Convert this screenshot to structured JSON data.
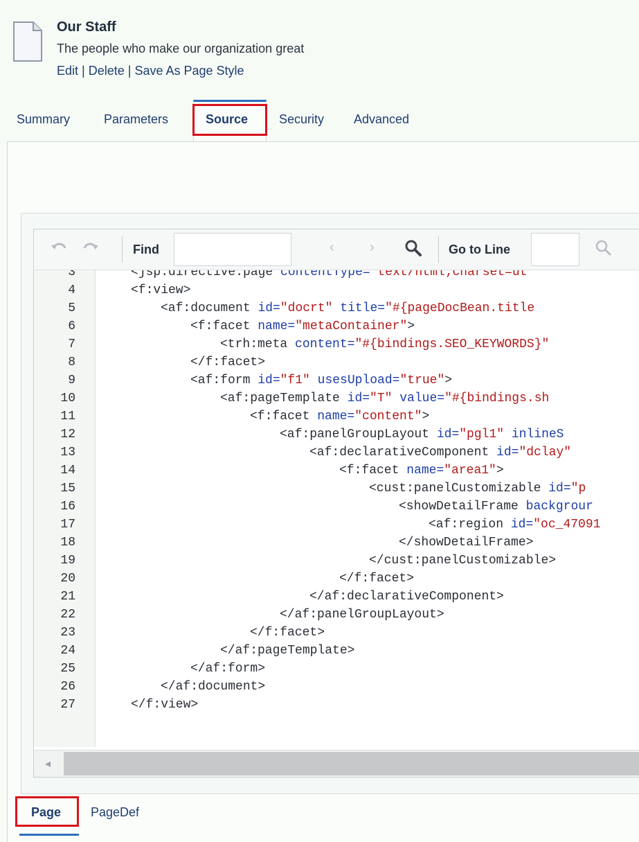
{
  "header": {
    "title": "Our Staff",
    "subtitle": "The people who make our organization great",
    "actions": [
      "Edit",
      "Delete",
      "Save As Page Style"
    ],
    "icon": "document-icon"
  },
  "tabs": [
    {
      "label": "Summary",
      "active": false
    },
    {
      "label": "Parameters",
      "active": false
    },
    {
      "label": "Source",
      "active": true
    },
    {
      "label": "Security",
      "active": false
    },
    {
      "label": "Advanced",
      "active": false
    }
  ],
  "toolbar": {
    "undo_icon": "undo-icon",
    "redo_icon": "redo-icon",
    "find_label": "Find",
    "find_value": "",
    "prev_icon": "chevron-left-icon",
    "next_icon": "chevron-right-icon",
    "search_icon": "search-icon",
    "goto_label": "Go to Line",
    "goto_value": "",
    "goto_search_icon": "search-icon"
  },
  "code_lines": [
    {
      "n": "3",
      "indent": 0,
      "parts": [
        [
          "t",
          "<jsp:directive.page "
        ],
        [
          "a",
          "contentType="
        ],
        [
          "v",
          "\"text/html;charset=ut"
        ]
      ]
    },
    {
      "n": "4",
      "indent": 0,
      "parts": [
        [
          "t",
          "<f:view>"
        ]
      ]
    },
    {
      "n": "5",
      "indent": 1,
      "parts": [
        [
          "t",
          "<af:document "
        ],
        [
          "a",
          "id="
        ],
        [
          "v",
          "\"docrt\""
        ],
        [
          "a",
          " title="
        ],
        [
          "v",
          "\"#{pageDocBean.title"
        ]
      ]
    },
    {
      "n": "6",
      "indent": 2,
      "parts": [
        [
          "t",
          "<f:facet "
        ],
        [
          "a",
          "name="
        ],
        [
          "v",
          "\"metaContainer\""
        ],
        [
          "t",
          ">"
        ]
      ]
    },
    {
      "n": "7",
      "indent": 3,
      "parts": [
        [
          "t",
          "<trh:meta "
        ],
        [
          "a",
          "content="
        ],
        [
          "v",
          "\"#{bindings.SEO_KEYWORDS}\""
        ]
      ]
    },
    {
      "n": "8",
      "indent": 2,
      "parts": [
        [
          "t",
          "</f:facet>"
        ]
      ]
    },
    {
      "n": "9",
      "indent": 2,
      "parts": [
        [
          "t",
          "<af:form "
        ],
        [
          "a",
          "id="
        ],
        [
          "v",
          "\"f1\""
        ],
        [
          "a",
          " usesUpload="
        ],
        [
          "v",
          "\"true\""
        ],
        [
          "t",
          ">"
        ]
      ]
    },
    {
      "n": "10",
      "indent": 3,
      "parts": [
        [
          "t",
          "<af:pageTemplate "
        ],
        [
          "a",
          "id="
        ],
        [
          "v",
          "\"T\""
        ],
        [
          "a",
          " value="
        ],
        [
          "v",
          "\"#{bindings.sh"
        ]
      ]
    },
    {
      "n": "11",
      "indent": 4,
      "parts": [
        [
          "t",
          "<f:facet "
        ],
        [
          "a",
          "name="
        ],
        [
          "v",
          "\"content\""
        ],
        [
          "t",
          ">"
        ]
      ]
    },
    {
      "n": "12",
      "indent": 5,
      "parts": [
        [
          "t",
          "<af:panelGroupLayout "
        ],
        [
          "a",
          "id="
        ],
        [
          "v",
          "\"pgl1\""
        ],
        [
          "a",
          " inlineS"
        ]
      ]
    },
    {
      "n": "13",
      "indent": 6,
      "parts": [
        [
          "t",
          "<af:declarativeComponent "
        ],
        [
          "a",
          "id="
        ],
        [
          "v",
          "\"dclay\""
        ]
      ]
    },
    {
      "n": "14",
      "indent": 7,
      "parts": [
        [
          "t",
          "<f:facet "
        ],
        [
          "a",
          "name="
        ],
        [
          "v",
          "\"area1\""
        ],
        [
          "t",
          ">"
        ]
      ]
    },
    {
      "n": "15",
      "indent": 8,
      "parts": [
        [
          "t",
          "<cust:panelCustomizable "
        ],
        [
          "a",
          "id="
        ],
        [
          "v",
          "\"p"
        ]
      ]
    },
    {
      "n": "16",
      "indent": 9,
      "parts": [
        [
          "t",
          "<showDetailFrame "
        ],
        [
          "a",
          "backgrour"
        ]
      ]
    },
    {
      "n": "17",
      "indent": 10,
      "parts": [
        [
          "t",
          "<af:region "
        ],
        [
          "a",
          "id="
        ],
        [
          "v",
          "\"oc_47091"
        ]
      ]
    },
    {
      "n": "18",
      "indent": 9,
      "parts": [
        [
          "t",
          "</showDetailFrame>"
        ]
      ]
    },
    {
      "n": "19",
      "indent": 8,
      "parts": [
        [
          "t",
          "</cust:panelCustomizable>"
        ]
      ]
    },
    {
      "n": "20",
      "indent": 7,
      "parts": [
        [
          "t",
          "</f:facet>"
        ]
      ]
    },
    {
      "n": "21",
      "indent": 6,
      "parts": [
        [
          "t",
          "</af:declarativeComponent>"
        ]
      ]
    },
    {
      "n": "22",
      "indent": 5,
      "parts": [
        [
          "t",
          "</af:panelGroupLayout>"
        ]
      ]
    },
    {
      "n": "23",
      "indent": 4,
      "parts": [
        [
          "t",
          "</f:facet>"
        ]
      ]
    },
    {
      "n": "24",
      "indent": 3,
      "parts": [
        [
          "t",
          "</af:pageTemplate>"
        ]
      ]
    },
    {
      "n": "25",
      "indent": 2,
      "parts": [
        [
          "t",
          "</af:form>"
        ]
      ]
    },
    {
      "n": "26",
      "indent": 1,
      "parts": [
        [
          "t",
          "</af:document>"
        ]
      ]
    },
    {
      "n": "27",
      "indent": 0,
      "parts": [
        [
          "t",
          "</f:view>"
        ]
      ]
    }
  ],
  "bottom_tabs": [
    {
      "label": "Page",
      "active": true
    },
    {
      "label": "PageDef",
      "active": false
    }
  ],
  "colors": {
    "link": "#1f3e6e",
    "highlight_box": "#d8111a",
    "active_tab_accent": "#2a6fbf",
    "code_attr": "#1e3ea8",
    "code_value": "#b11a1a"
  }
}
